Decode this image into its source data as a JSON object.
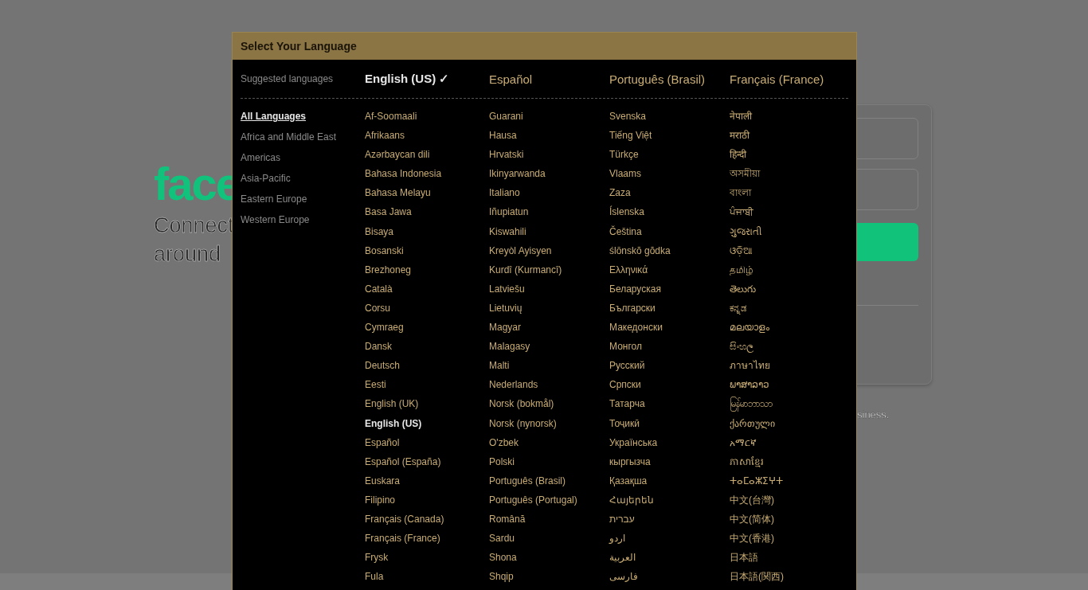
{
  "background_page": {
    "logo": "face",
    "tagline": [
      "Connect",
      "around"
    ],
    "footer_text": "siness."
  },
  "dialog": {
    "title": "Select Your Language",
    "suggested_label": "Suggested languages",
    "suggested": [
      {
        "label": "English (US)",
        "check": "✓",
        "selected": true
      },
      {
        "label": "Español",
        "selected": false
      },
      {
        "label": "Português (Brasil)",
        "selected": false
      },
      {
        "label": "Français (France)",
        "selected": false
      }
    ],
    "regions": [
      {
        "label": "All Languages",
        "selected": true
      },
      {
        "label": "Africa and Middle East",
        "selected": false
      },
      {
        "label": "Americas",
        "selected": false
      },
      {
        "label": "Asia-Pacific",
        "selected": false
      },
      {
        "label": "Eastern Europe",
        "selected": false
      },
      {
        "label": "Western Europe",
        "selected": false
      }
    ],
    "language_columns": [
      [
        {
          "label": "Af-Soomaali",
          "selected": false
        },
        {
          "label": "Afrikaans",
          "selected": false
        },
        {
          "label": "Azərbaycan dili",
          "selected": false
        },
        {
          "label": "Bahasa Indonesia",
          "selected": false
        },
        {
          "label": "Bahasa Melayu",
          "selected": false
        },
        {
          "label": "Basa Jawa",
          "selected": false
        },
        {
          "label": "Bisaya",
          "selected": false
        },
        {
          "label": "Bosanski",
          "selected": false
        },
        {
          "label": "Brezhoneg",
          "selected": false
        },
        {
          "label": "Català",
          "selected": false
        },
        {
          "label": "Corsu",
          "selected": false
        },
        {
          "label": "Cymraeg",
          "selected": false
        },
        {
          "label": "Dansk",
          "selected": false
        },
        {
          "label": "Deutsch",
          "selected": false
        },
        {
          "label": "Eesti",
          "selected": false
        },
        {
          "label": "English (UK)",
          "selected": false
        },
        {
          "label": "English (US)",
          "selected": true
        },
        {
          "label": "Español",
          "selected": false
        },
        {
          "label": "Español (España)",
          "selected": false
        },
        {
          "label": "Euskara",
          "selected": false
        },
        {
          "label": "Filipino",
          "selected": false
        },
        {
          "label": "Français (Canada)",
          "selected": false
        },
        {
          "label": "Français (France)",
          "selected": false
        },
        {
          "label": "Frysk",
          "selected": false
        },
        {
          "label": "Fula",
          "selected": false
        }
      ],
      [
        {
          "label": "Guarani",
          "selected": false
        },
        {
          "label": "Hausa",
          "selected": false
        },
        {
          "label": "Hrvatski",
          "selected": false
        },
        {
          "label": "Ikinyarwanda",
          "selected": false
        },
        {
          "label": "Italiano",
          "selected": false
        },
        {
          "label": "Iñupiatun",
          "selected": false
        },
        {
          "label": "Kiswahili",
          "selected": false
        },
        {
          "label": "Kreyòl Ayisyen",
          "selected": false
        },
        {
          "label": "Kurdî (Kurmancî)",
          "selected": false
        },
        {
          "label": "Latviešu",
          "selected": false
        },
        {
          "label": "Lietuvių",
          "selected": false
        },
        {
          "label": "Magyar",
          "selected": false
        },
        {
          "label": "Malagasy",
          "selected": false
        },
        {
          "label": "Malti",
          "selected": false
        },
        {
          "label": "Nederlands",
          "selected": false
        },
        {
          "label": "Norsk (bokmål)",
          "selected": false
        },
        {
          "label": "Norsk (nynorsk)",
          "selected": false
        },
        {
          "label": "O'zbek",
          "selected": false
        },
        {
          "label": "Polski",
          "selected": false
        },
        {
          "label": "Português (Brasil)",
          "selected": false
        },
        {
          "label": "Português (Portugal)",
          "selected": false
        },
        {
          "label": "Română",
          "selected": false
        },
        {
          "label": "Sardu",
          "selected": false
        },
        {
          "label": "Shona",
          "selected": false
        },
        {
          "label": "Shqip",
          "selected": false
        }
      ],
      [
        {
          "label": "Svenska",
          "selected": false
        },
        {
          "label": "Tiếng Việt",
          "selected": false
        },
        {
          "label": "Türkçe",
          "selected": false
        },
        {
          "label": "Vlaams",
          "selected": false
        },
        {
          "label": "Zaza",
          "selected": false
        },
        {
          "label": "Íslenska",
          "selected": false
        },
        {
          "label": "Čeština",
          "selected": false
        },
        {
          "label": "ślōnskŏ gŏdka",
          "selected": false
        },
        {
          "label": "Ελληνικά",
          "selected": false
        },
        {
          "label": "Беларуская",
          "selected": false
        },
        {
          "label": "Български",
          "selected": false
        },
        {
          "label": "Македонски",
          "selected": false
        },
        {
          "label": "Монгол",
          "selected": false
        },
        {
          "label": "Русский",
          "selected": false
        },
        {
          "label": "Српски",
          "selected": false
        },
        {
          "label": "Татарча",
          "selected": false
        },
        {
          "label": "Тоҷикӣ",
          "selected": false
        },
        {
          "label": "Українська",
          "selected": false
        },
        {
          "label": "кыргызча",
          "selected": false
        },
        {
          "label": "Қазақша",
          "selected": false
        },
        {
          "label": "Հայերեն",
          "selected": false
        },
        {
          "label": "עברית",
          "selected": false
        },
        {
          "label": "اردو",
          "selected": false
        },
        {
          "label": "العربية",
          "selected": false
        },
        {
          "label": "فارسی",
          "selected": false
        }
      ],
      [
        {
          "label": "नेपाली",
          "selected": false
        },
        {
          "label": "मराठी",
          "selected": false
        },
        {
          "label": "हिन्दी",
          "selected": false
        },
        {
          "label": "অসমীয়া",
          "selected": false
        },
        {
          "label": "বাংলা",
          "selected": false
        },
        {
          "label": "ਪੰਜਾਬੀ",
          "selected": false
        },
        {
          "label": "ગુજરાતી",
          "selected": false
        },
        {
          "label": "ଓଡ଼ିଆ",
          "selected": false
        },
        {
          "label": "தமிழ்",
          "selected": false
        },
        {
          "label": "తెలుగు",
          "selected": false
        },
        {
          "label": "ಕನ್ನಡ",
          "selected": false
        },
        {
          "label": "മലയാളം",
          "selected": false
        },
        {
          "label": "සිංහල",
          "selected": false
        },
        {
          "label": "ภาษาไทย",
          "selected": false
        },
        {
          "label": "ພາສາລາວ",
          "selected": false
        },
        {
          "label": "မြန်မာဘာသာ",
          "selected": false
        },
        {
          "label": "ქართული",
          "selected": false
        },
        {
          "label": "አማርኛ",
          "selected": false
        },
        {
          "label": "ភាសាខ្មែរ",
          "selected": false
        },
        {
          "label": "ⵜⴰⵎⴰⵣⵉⵖⵜ",
          "selected": false
        },
        {
          "label": "中文(台灣)",
          "selected": false
        },
        {
          "label": "中文(简体)",
          "selected": false
        },
        {
          "label": "中文(香港)",
          "selected": false
        },
        {
          "label": "日本語",
          "selected": false
        },
        {
          "label": "日本語(関西)",
          "selected": false
        }
      ]
    ]
  }
}
